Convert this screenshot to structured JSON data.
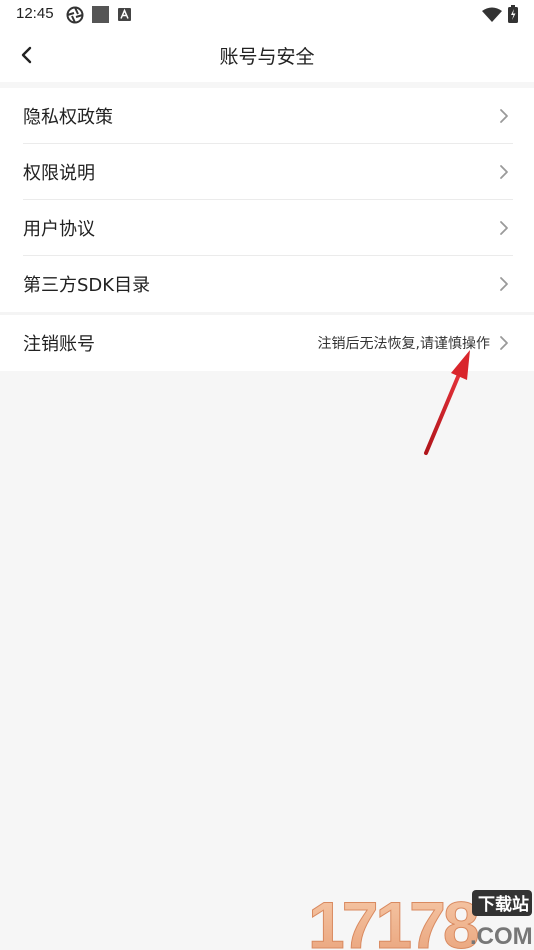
{
  "status_bar": {
    "time": "12:45",
    "icons": [
      "aperture-icon",
      "square-icon",
      "a-notification-icon",
      "wifi-icon",
      "battery-charging-icon"
    ]
  },
  "header": {
    "back_icon": "chevron-left-icon",
    "title": "账号与安全"
  },
  "menu": {
    "items": [
      {
        "label": "隐私权政策"
      },
      {
        "label": "权限说明"
      },
      {
        "label": "用户协议"
      },
      {
        "label": "第三方SDK目录"
      }
    ]
  },
  "cancel_account": {
    "label": "注销账号",
    "hint": "注销后无法恢复,请谨慎操作"
  },
  "annotation": {
    "color": "#d9262c"
  },
  "watermark": {
    "number": "17178",
    "tag": "下载站",
    "suffix": ".COM"
  },
  "colors": {
    "background": "#f6f6f6",
    "surface": "#ffffff",
    "text": "#222222",
    "chevron": "#9a9a9a"
  }
}
